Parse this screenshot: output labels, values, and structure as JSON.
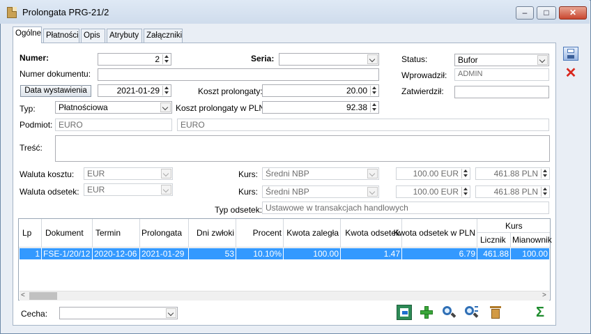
{
  "window": {
    "title": "Prolongata PRG-21/2",
    "min": "‒",
    "max": "□",
    "close": "✕"
  },
  "tabs": [
    {
      "label": "Ogólne",
      "active": true
    },
    {
      "label": "Płatności"
    },
    {
      "label": "Opis"
    },
    {
      "label": "Atrybuty"
    },
    {
      "label": "Załączniki"
    }
  ],
  "form": {
    "numer_label": "Numer:",
    "numer_value": "2",
    "seria_label": "Seria:",
    "seria_value": "",
    "status_label": "Status:",
    "status_value": "Bufor",
    "numer_dok_label": "Numer dokumentu:",
    "numer_dok_value": "",
    "wprowadzil_label": "Wprowadził:",
    "wprowadzil_value": "ADMIN",
    "data_btn": "Data wystawienia",
    "data_value": "2021-01-29",
    "koszt_label": "Koszt prolongaty:",
    "koszt_value": "20.00",
    "zatwierdzil_label": "Zatwierdził:",
    "zatwierdzil_value": "",
    "typ_label": "Typ:",
    "typ_value": "Płatnościowa",
    "koszt_pln_label": "Koszt prolongaty w PLN:",
    "koszt_pln_value": "92.38",
    "podmiot_label": "Podmiot:",
    "podmiot_code": "EURO",
    "podmiot_name": "EURO",
    "tresc_label": "Treść:",
    "tresc_value": "",
    "waluta_kosztu_label": "Waluta kosztu:",
    "waluta_kosztu_value": "EUR",
    "kurs1_label": "Kurs:",
    "kurs1_value": "Średni NBP",
    "kurs1_eur": "100.00 EUR",
    "kurs1_pln": "461.88 PLN",
    "waluta_odsetek_label": "Waluta odsetek:",
    "waluta_odsetek_value": "EUR",
    "kurs2_label": "Kurs:",
    "kurs2_value": "Średni NBP",
    "kurs2_eur": "100.00 EUR",
    "kurs2_pln": "461.88 PLN",
    "typ_odsetek_label": "Typ odsetek:",
    "typ_odsetek_value": "Ustawowe w transakcjach handlowych",
    "cecha_label": "Cecha:",
    "cecha_value": ""
  },
  "table": {
    "headers": [
      "Lp",
      "Dokument",
      "Termin",
      "Prolongata",
      "Dni zwłoki",
      "Procent",
      "Kwota zaległa",
      "Kwota odsetek",
      "Kwota odsetek w PLN"
    ],
    "kurs_header": "Kurs",
    "kurs_sub": [
      "Licznik",
      "Mianownik"
    ],
    "rows": [
      [
        "1",
        "FSE-1/20/12",
        "2020-12-06",
        "2021-01-29",
        "53",
        "10.10%",
        "100.00",
        "1.47",
        "6.79",
        "461.88",
        "100.00"
      ]
    ]
  },
  "colors": {
    "accent": "#3399ff",
    "window_bg": "#e9eef5"
  },
  "icons": [
    "save-icon",
    "cancel-icon",
    "export-icon",
    "add-icon",
    "search-icon",
    "search-list-icon",
    "trash-icon",
    "sum-icon"
  ]
}
